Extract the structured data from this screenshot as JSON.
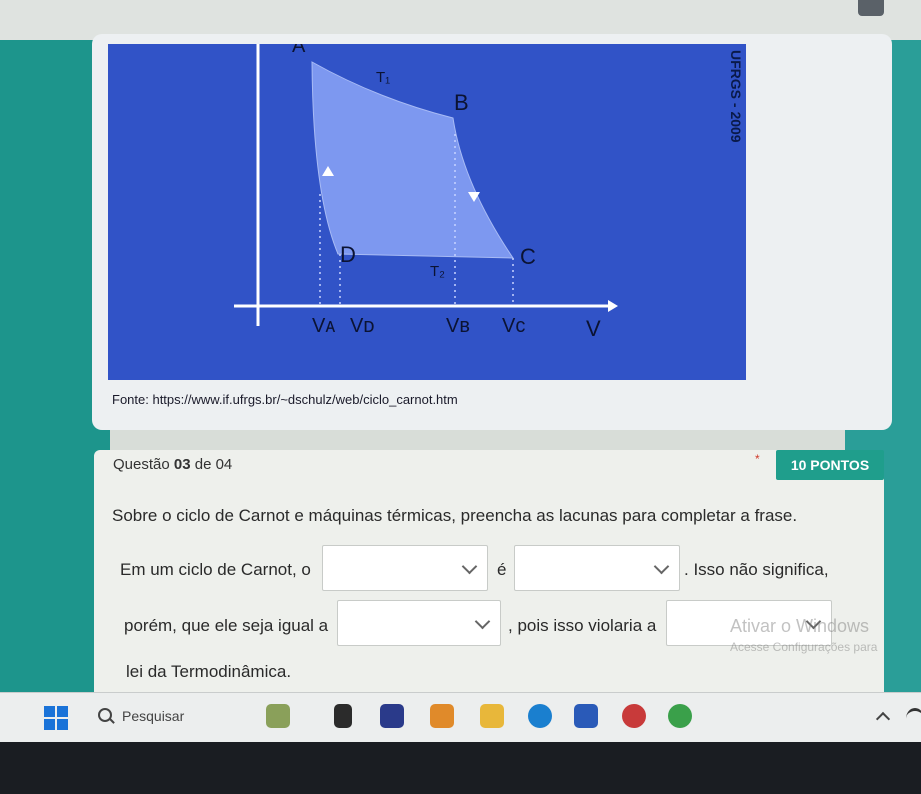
{
  "figure": {
    "labels": {
      "point_a": "A",
      "point_b": "B",
      "point_c": "C",
      "point_d": "D",
      "t1": "T₁",
      "t2": "T₂",
      "va": "Vᴀ",
      "vd": "Vᴅ",
      "vb": "Vʙ",
      "vc": "Vᴄ",
      "v_axis": "V"
    },
    "watermark": "UFRGS - 2009",
    "colors": {
      "background": "#3153c7",
      "fill": "#7d98f0",
      "axis": "#ffffff"
    }
  },
  "source": "Fonte: https://www.if.ufrgs.br/~dschulz/web/ciclo_carnot.htm",
  "question": {
    "prefix": "Questão ",
    "number": "03",
    "suffix": " de 04",
    "points": "10 PONTOS",
    "required_mark": "*",
    "statement": "Sobre o ciclo de Carnot e máquinas térmicas, preencha as lacunas para completar a frase.",
    "line1_part1": "Em um ciclo de Carnot, o",
    "line1_part2": "é",
    "line1_part3": ". Isso não significa,",
    "line2_part1": "porém, que ele seja igual a",
    "line2_part2": ", pois isso violaria a",
    "line3": "lei da Termodinâmica.",
    "dropdowns": [
      {
        "selected": ""
      },
      {
        "selected": ""
      },
      {
        "selected": ""
      },
      {
        "selected": ""
      }
    ]
  },
  "windows_watermark": {
    "title": "Ativar o Windows",
    "subtitle": "Acesse Configurações para"
  },
  "taskbar": {
    "search_placeholder": "Pesquisar",
    "apps": [
      "widgets-icon",
      "files-icon",
      "video-icon",
      "paint-icon",
      "folder-icon",
      "edge-icon",
      "store-icon",
      "opera-icon",
      "chrome-icon"
    ]
  }
}
